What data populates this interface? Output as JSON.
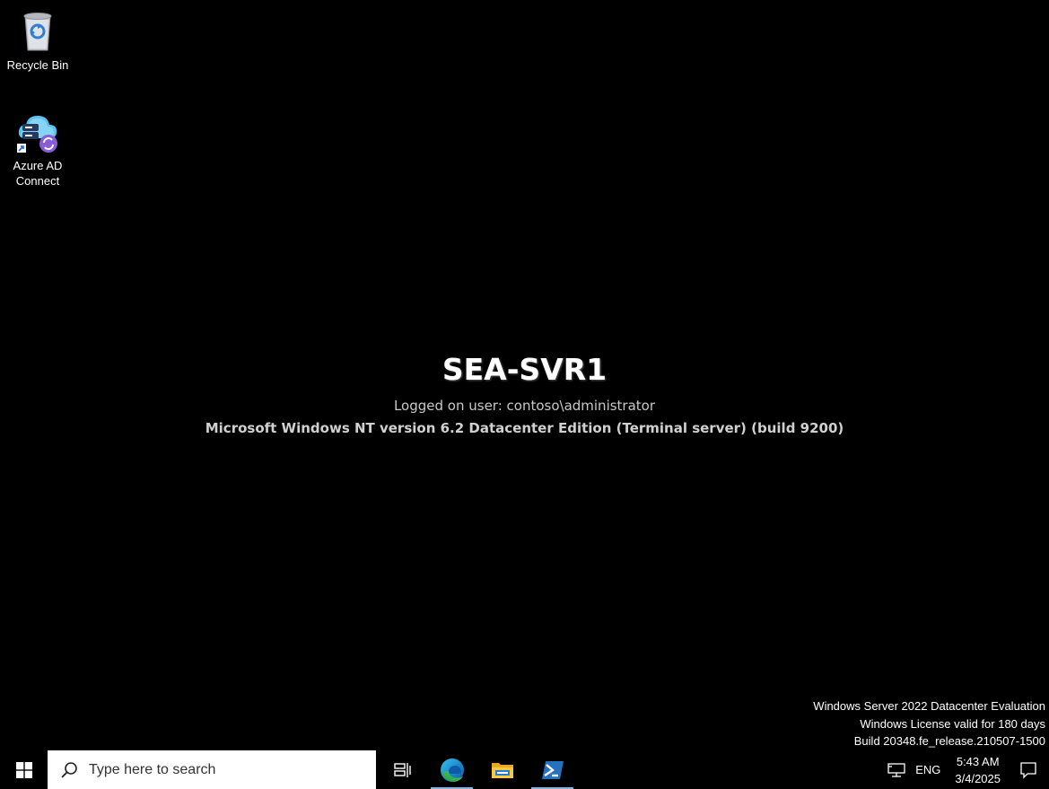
{
  "desktop": {
    "icons": [
      {
        "label": "Recycle Bin",
        "icon": "recycle-bin-icon"
      },
      {
        "label": "Azure AD\nConnect",
        "label_line1": "Azure AD",
        "label_line2": "Connect",
        "icon": "azure-ad-connect-icon"
      }
    ]
  },
  "bginfo": {
    "hostname": "SEA-SVR1",
    "logged_on": "Logged on user: contoso\\administrator",
    "os": "Microsoft Windows NT version 6.2 Datacenter Edition (Terminal server)  (build 9200)"
  },
  "watermark": {
    "line1": "Windows Server 2022 Datacenter Evaluation",
    "line2": "Windows License valid for 180 days",
    "line3": "Build 20348.fe_release.210507-1500"
  },
  "taskbar": {
    "search_placeholder": "Type here to search",
    "apps": [
      {
        "name": "Task View",
        "icon": "task-view-icon"
      },
      {
        "name": "Microsoft Edge",
        "icon": "edge-icon"
      },
      {
        "name": "File Explorer",
        "icon": "file-explorer-icon"
      },
      {
        "name": "Windows PowerShell",
        "icon": "powershell-icon"
      }
    ],
    "tray": {
      "language": "ENG",
      "time": "5:43 AM",
      "date": "3/4/2025"
    }
  },
  "colors": {
    "background": "#000000",
    "taskbar": "#000000",
    "search_box": "#ffffff",
    "running_indicator": "#7fb2e5"
  }
}
